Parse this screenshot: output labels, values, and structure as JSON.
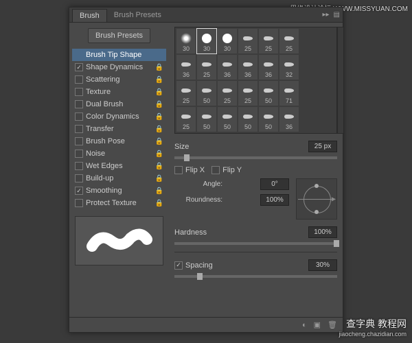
{
  "watermark_top": "思缘设计论坛 WWW.MISSYUAN.COM",
  "watermark_bottom": {
    "main": "查字典 教程网",
    "sub": "jiaocheng.chazidian.com"
  },
  "tabs": {
    "brush": "Brush",
    "presets": "Brush Presets"
  },
  "sidebar": {
    "presets_btn": "Brush Presets",
    "items": [
      {
        "label": "Brush Tip Shape",
        "selected": true,
        "chk": null,
        "lock": false
      },
      {
        "label": "Shape Dynamics",
        "chk": true,
        "lock": true
      },
      {
        "label": "Scattering",
        "chk": false,
        "lock": true
      },
      {
        "label": "Texture",
        "chk": false,
        "lock": true
      },
      {
        "label": "Dual Brush",
        "chk": false,
        "lock": true
      },
      {
        "label": "Color Dynamics",
        "chk": false,
        "lock": true
      },
      {
        "label": "Transfer",
        "chk": false,
        "lock": true
      },
      {
        "label": "Brush Pose",
        "chk": false,
        "lock": true
      },
      {
        "label": "Noise",
        "chk": false,
        "lock": true
      },
      {
        "label": "Wet Edges",
        "chk": false,
        "lock": true
      },
      {
        "label": "Build-up",
        "chk": false,
        "lock": true
      },
      {
        "label": "Smoothing",
        "chk": true,
        "lock": true
      },
      {
        "label": "Protect Texture",
        "chk": false,
        "lock": true
      }
    ]
  },
  "tips": [
    {
      "v": "30",
      "t": "soft"
    },
    {
      "v": "30",
      "t": "hard",
      "sel": true
    },
    {
      "v": "30",
      "t": "hard"
    },
    {
      "v": "25",
      "t": "b"
    },
    {
      "v": "25",
      "t": "b"
    },
    {
      "v": "25",
      "t": "b"
    },
    {
      "v": "36",
      "t": "b"
    },
    {
      "v": "25",
      "t": "b"
    },
    {
      "v": "36",
      "t": "b"
    },
    {
      "v": "36",
      "t": "b"
    },
    {
      "v": "36",
      "t": "b"
    },
    {
      "v": "32",
      "t": "b"
    },
    {
      "v": "25",
      "t": "b"
    },
    {
      "v": "50",
      "t": "b"
    },
    {
      "v": "25",
      "t": "b"
    },
    {
      "v": "25",
      "t": "b"
    },
    {
      "v": "50",
      "t": "b"
    },
    {
      "v": "71",
      "t": "b"
    },
    {
      "v": "25",
      "t": "b"
    },
    {
      "v": "50",
      "t": "b"
    },
    {
      "v": "50",
      "t": "b"
    },
    {
      "v": "50",
      "t": "b"
    },
    {
      "v": "50",
      "t": "b"
    },
    {
      "v": "36",
      "t": "b"
    }
  ],
  "controls": {
    "size_label": "Size",
    "size_val": "25 px",
    "flipx": "Flip X",
    "flipy": "Flip Y",
    "angle_label": "Angle:",
    "angle_val": "0°",
    "round_label": "Roundness:",
    "round_val": "100%",
    "hard_label": "Hardness",
    "hard_val": "100%",
    "spacing_label": "Spacing",
    "spacing_val": "30%"
  }
}
